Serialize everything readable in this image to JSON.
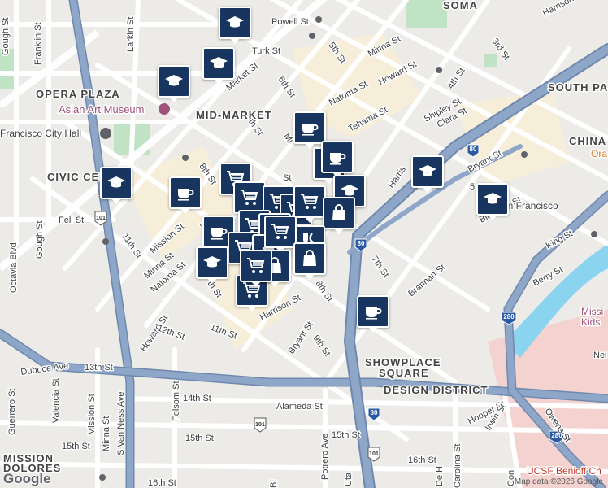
{
  "map": {
    "streets": {
      "powell": "Powell St",
      "harrison_top": "Harrison St",
      "minna_top": "Minna St",
      "fifth": "5th St",
      "third": "3rd St",
      "turk": "Turk St",
      "howard_top": "Howard St",
      "fourth": "4th St",
      "market": "Market St",
      "sixth": "6th St",
      "natoma_top": "Natoma St",
      "shipley": "Shipley St",
      "clara": "Clara St",
      "tehama": "Tehama St",
      "seventh_top": "7th St",
      "mi_partial": "Mi",
      "bryant_top": "Bryant St",
      "harris_partial": "Harris",
      "eighth_top": "8th St",
      "st_partial": "St",
      "fifth_partial": "5",
      "fell": "Fell St",
      "mission_left": "Mission St",
      "eleventh": "11th St",
      "minna_left": "Minna St",
      "natoma_left": "Natoma St",
      "gough_top": "Gough St",
      "franklin": "Franklin St",
      "larkin": "Larkin St",
      "gough_left": "Gough St",
      "octavia": "Octavia Blvd",
      "th_partial": "th St",
      "nine_partial": "9",
      "howard_left": "Howard St",
      "twelfth": "12th St",
      "eleventh_lower": "11th St",
      "harrison_mid": "Harrison St",
      "eighth_mid": "8th St",
      "seventh_mid": "7th St",
      "brannan": "Brannan St",
      "bluxome": "Bluxome St",
      "king": "King St",
      "berry": "Berry St",
      "bryant_low": "Bryant St",
      "ninth": "9th St",
      "duboce": "Duboce Ave",
      "thirteenth": "13th St",
      "valencia": "Valencia St",
      "guerrero": "Guerrero St",
      "mission_low": "Mission St",
      "svanness": "S Van Ness Ave",
      "folsom": "Folsom St",
      "fourteenth": "14th St",
      "alameda": "Alameda St",
      "fifteenth_left": "15th St",
      "fifteenth_right": "15th St",
      "fifteenth_mid": "15th St",
      "minna_low": "Minna St",
      "bi_partial": "Bi",
      "potrero": "Potrero Ave",
      "uta_partial": "Uta",
      "sixteenth_left": "16th St",
      "sixteenth_right": "16th St",
      "de_partial": "De H",
      "carolina": "Carolina St",
      "con_partial": "Con",
      "hooper": "Hooper St",
      "irwin": "Irwin St",
      "owens": "Owens St",
      "nel_partial": "Nel"
    },
    "areas": {
      "soma": "SOMA",
      "opera_plaza": "OPERA PLAZA",
      "mid_market": "MID-MARKET",
      "civic_center": "CIVIC CENTER",
      "south_park": "SOUTH PAR",
      "china": "CHINA",
      "showplace_1": "SHOWPLACE",
      "showplace_2": "SQUARE",
      "design_district": "DESIGN DISTRICT",
      "mission_1": "MISSION",
      "mission_2": "DOLORES"
    },
    "pois": {
      "asian_art": "Asian Art Museum",
      "city_hall": "Francisco City Hall",
      "ora": "Ora",
      "san_francisco": "an Francisco",
      "missi": "Missi",
      "kids": "Kids",
      "ucsf": "UCSF Benioff Ch"
    },
    "shields": {
      "us101_a": "101",
      "us101_b": "101",
      "us101_c": "101",
      "i80_a": "80",
      "i80_b": "80",
      "i80_c": "80",
      "i280_a": "280",
      "i280_b": "280"
    },
    "colors": {
      "background": "#ecebe8",
      "highway": "#8ea6c8",
      "highway_outline": "#6f88ad",
      "street": "#ffffff",
      "park": "#bfe3c4",
      "water": "#8ad4f0",
      "commercial": "#f6eed9",
      "hospital": "#f4d2cf",
      "marker": "#17355e",
      "poi_text": "#a0527a"
    }
  },
  "markers": [
    {
      "type": "school",
      "icon": "graduation-cap-icon"
    },
    {
      "type": "school",
      "icon": "graduation-cap-icon"
    },
    {
      "type": "school",
      "icon": "graduation-cap-icon"
    },
    {
      "type": "cafe",
      "icon": "coffee-cup-icon"
    },
    {
      "type": "cafe",
      "icon": "coffee-cup-icon"
    },
    {
      "type": "cafe",
      "icon": "coffee-cup-icon"
    },
    {
      "type": "school",
      "icon": "graduation-cap-icon"
    },
    {
      "type": "cafe",
      "icon": "coffee-cup-icon"
    },
    {
      "type": "grocery",
      "icon": "shopping-cart-icon"
    },
    {
      "type": "grocery",
      "icon": "shopping-cart-icon"
    },
    {
      "type": "grocery",
      "icon": "shopping-cart-icon"
    },
    {
      "type": "grocery",
      "icon": "shopping-cart-icon"
    },
    {
      "type": "grocery",
      "icon": "shopping-cart-icon"
    },
    {
      "type": "school",
      "icon": "graduation-cap-icon"
    },
    {
      "type": "shopping",
      "icon": "shopping-bag-icon"
    },
    {
      "type": "school",
      "icon": "graduation-cap-icon"
    },
    {
      "type": "school",
      "icon": "graduation-cap-icon"
    },
    {
      "type": "cafe",
      "icon": "coffee-cup-icon"
    },
    {
      "type": "grocery",
      "icon": "shopping-cart-icon"
    },
    {
      "type": "grocery",
      "icon": "shopping-cart-icon"
    },
    {
      "type": "grocery",
      "icon": "shopping-cart-icon"
    },
    {
      "type": "shopping",
      "icon": "shopping-bag-icon"
    },
    {
      "type": "restaurant",
      "icon": "fork-knife-icon"
    },
    {
      "type": "grocery",
      "icon": "shopping-cart-icon"
    },
    {
      "type": "school",
      "icon": "graduation-cap-icon"
    },
    {
      "type": "grocery",
      "icon": "shopping-cart-icon"
    },
    {
      "type": "shopping",
      "icon": "shopping-bag-icon"
    },
    {
      "type": "shopping",
      "icon": "shopping-bag-icon"
    },
    {
      "type": "grocery",
      "icon": "shopping-cart-icon"
    },
    {
      "type": "cafe",
      "icon": "coffee-cup-icon"
    }
  ],
  "footer": {
    "logo": "Google",
    "attribution": "Map data ©2026 Google"
  }
}
